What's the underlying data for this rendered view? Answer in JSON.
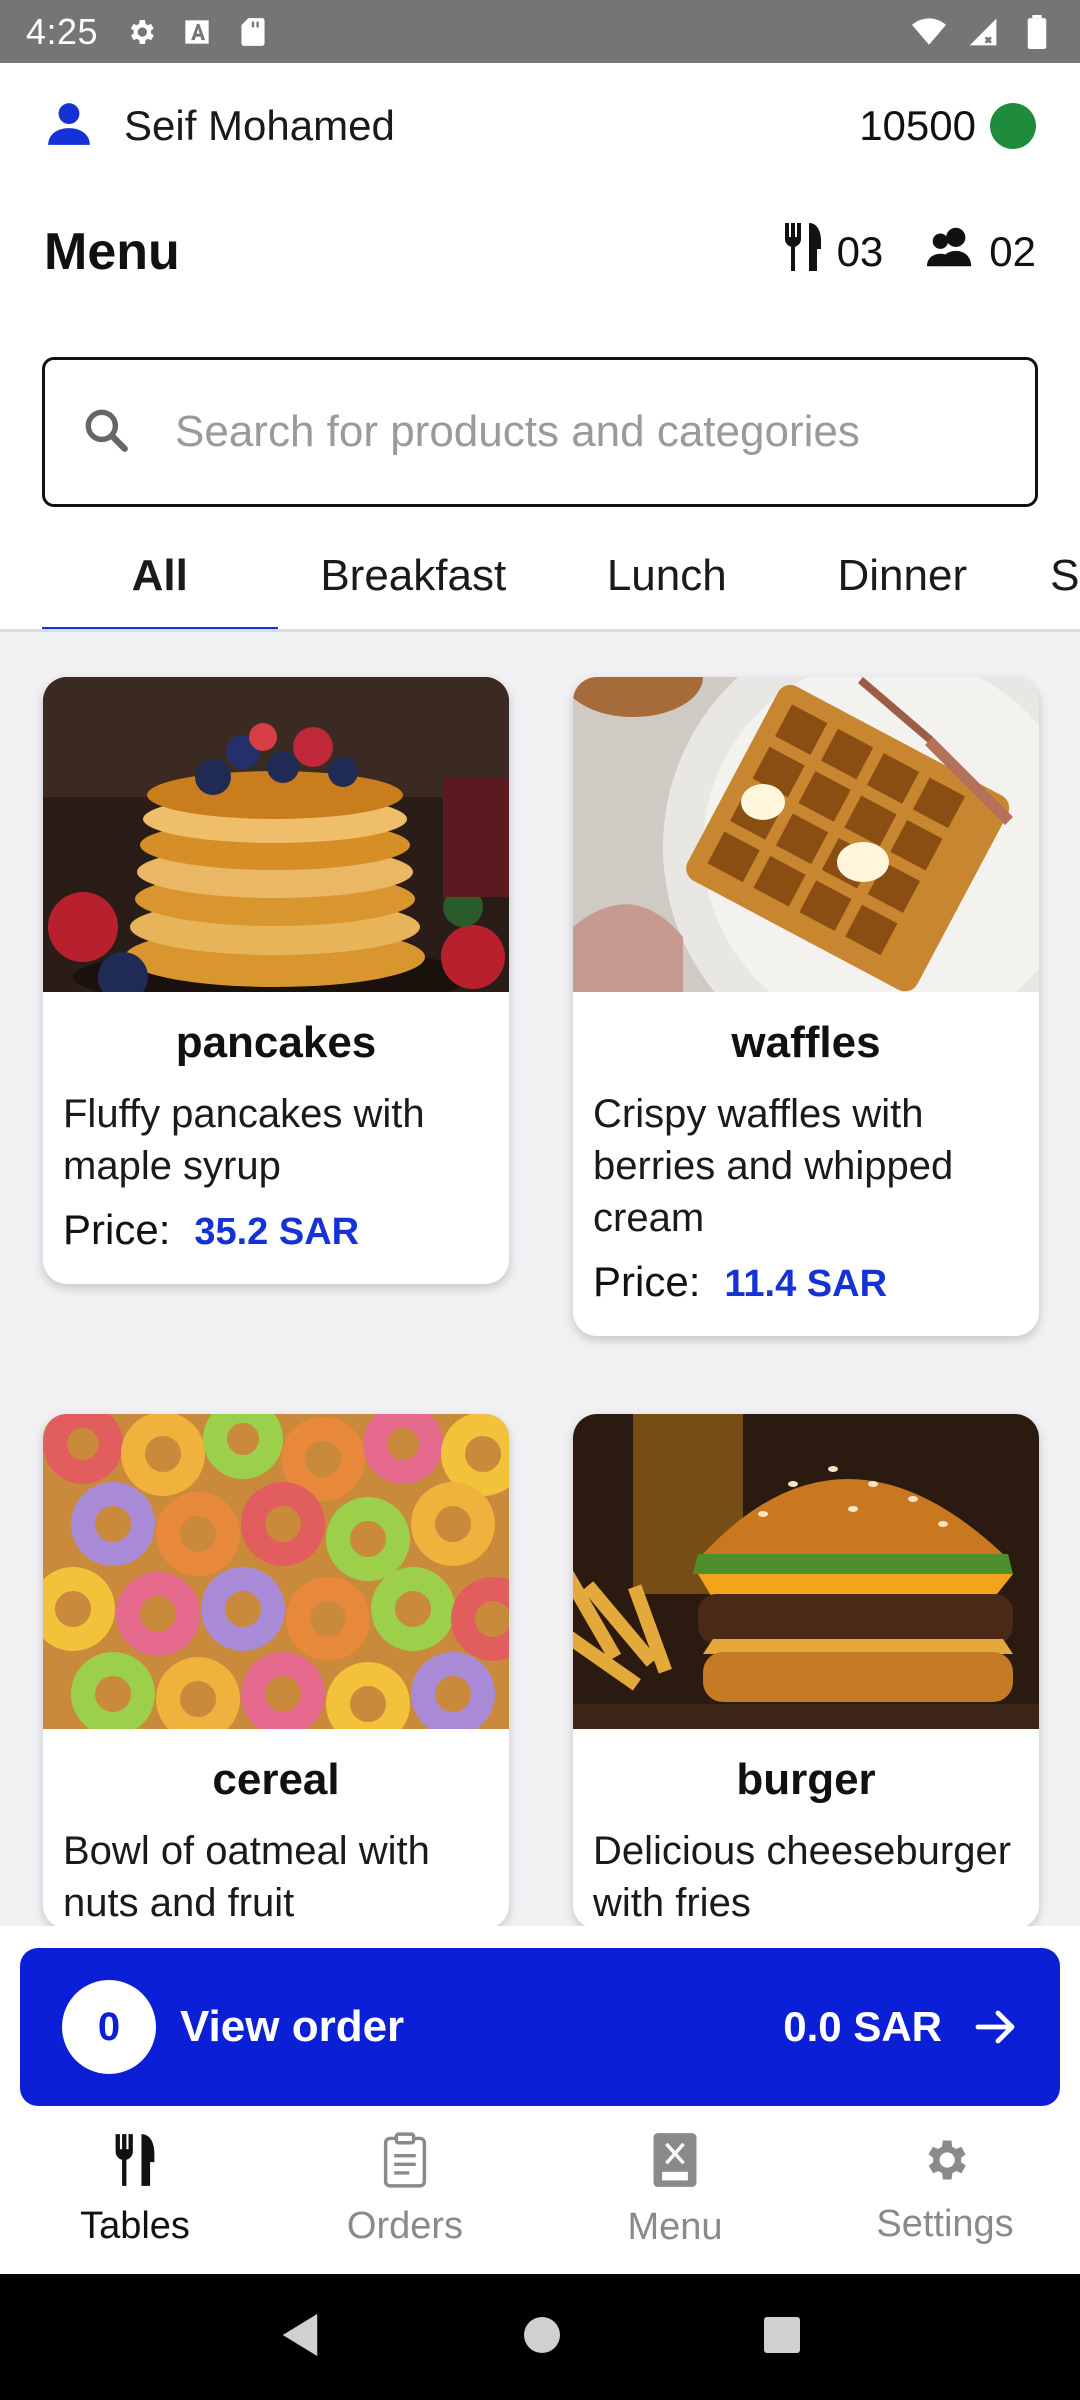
{
  "status_bar": {
    "time": "4:25",
    "icons": [
      "gear-icon",
      "a-icon",
      "sd-card-icon",
      "wifi-icon",
      "signal-icon",
      "battery-icon"
    ]
  },
  "user": {
    "name": "Seif Mohamed",
    "balance": "10500",
    "status_color": "#1e8c3a"
  },
  "header": {
    "title": "Menu",
    "tables_count": "03",
    "guests_count": "02"
  },
  "search": {
    "placeholder": "Search for products and categories"
  },
  "tabs": [
    {
      "label": "All",
      "active": true
    },
    {
      "label": "Breakfast",
      "active": false
    },
    {
      "label": "Lunch",
      "active": false
    },
    {
      "label": "Dinner",
      "active": false
    },
    {
      "label": "S",
      "active": false
    }
  ],
  "products": [
    {
      "name": "pancakes",
      "description": "Fluffy pancakes with maple syrup",
      "price_label": "Price:",
      "price": "35.2 SAR"
    },
    {
      "name": "waffles",
      "description": "Crispy waffles with berries and whipped cream",
      "price_label": "Price:",
      "price": "11.4 SAR"
    },
    {
      "name": "cereal",
      "description": "Bowl of oatmeal with nuts and fruit"
    },
    {
      "name": "burger",
      "description": "Delicious cheeseburger with fries"
    }
  ],
  "order": {
    "count": "0",
    "label": "View order",
    "total": "0.0 SAR"
  },
  "bottom_nav": [
    {
      "label": "Tables",
      "icon": "utensils-icon",
      "active": true
    },
    {
      "label": "Orders",
      "icon": "clipboard-icon",
      "active": false
    },
    {
      "label": "Menu",
      "icon": "menu-book-icon",
      "active": false
    },
    {
      "label": "Settings",
      "icon": "gear-icon",
      "active": false
    }
  ],
  "colors": {
    "accent": "#1532d6",
    "order_bar": "#0a1fd6",
    "background": "#f1f1f4"
  }
}
